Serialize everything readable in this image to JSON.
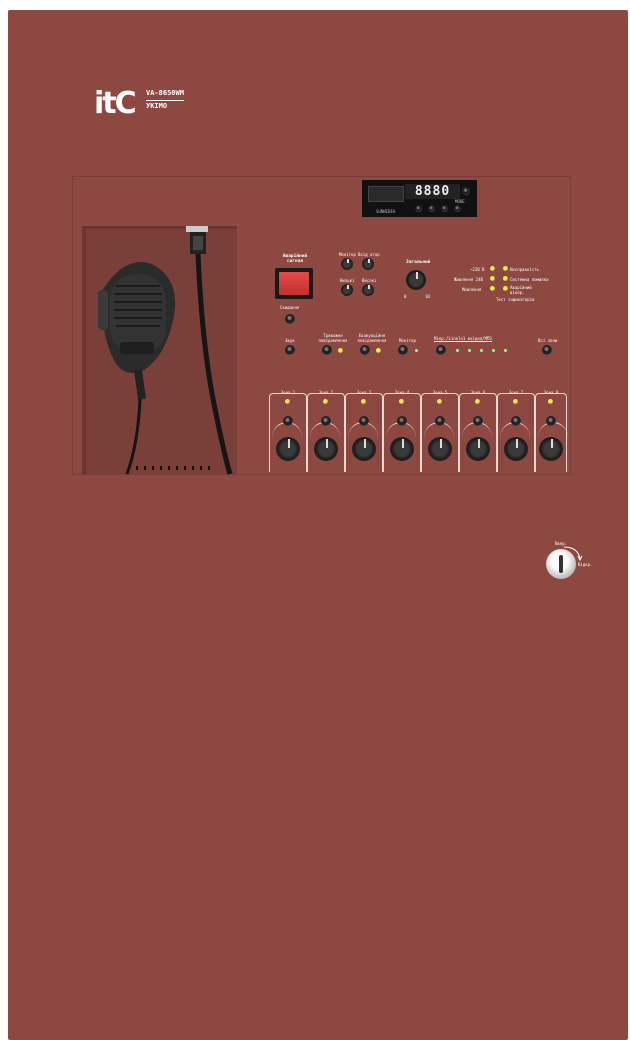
{
  "brand": {
    "logo": "itC",
    "model": "VA-8650WM",
    "variant": "УКІМО"
  },
  "player": {
    "display": "8880",
    "label": "SUNNIDEA",
    "mode": "MODE"
  },
  "emergency": {
    "label": "Аварійний сигнал",
    "reset_label": "Скидання"
  },
  "controls": {
    "monitor_top": "Монітор",
    "input_top": "Вхід атор",
    "low": "Низькі",
    "high": "Високі",
    "general": "Загальний",
    "scale_min": "0",
    "scale_max": "10"
  },
  "status": {
    "left": [
      "~220 В",
      "Живлення 24В",
      "Mовлення"
    ],
    "right": [
      "Несправність",
      "Системна помилка",
      "Аварійний вікор."
    ],
    "test": "Тест індикаторів"
  },
  "buttons": {
    "chime": "Звук",
    "alarm": "Тривожне повідомлення",
    "evac": "Евакуаційне повідомлення",
    "monitor": "Монітор",
    "mic_range": "Мікр./Lineln1 вхідна/МП3",
    "all_zones": "Всі зони"
  },
  "zones": [
    "Зона 1",
    "Зона 2",
    "Зона 3",
    "Зона 4",
    "Зона 5",
    "Зона 6",
    "Зона 7",
    "Зона 8"
  ],
  "key": {
    "on": "Ввер.",
    "off": "Відкр."
  },
  "colors": {
    "cabinet": "#8c4841",
    "led": "#ffec5a",
    "red_button": "#d63b3a"
  }
}
